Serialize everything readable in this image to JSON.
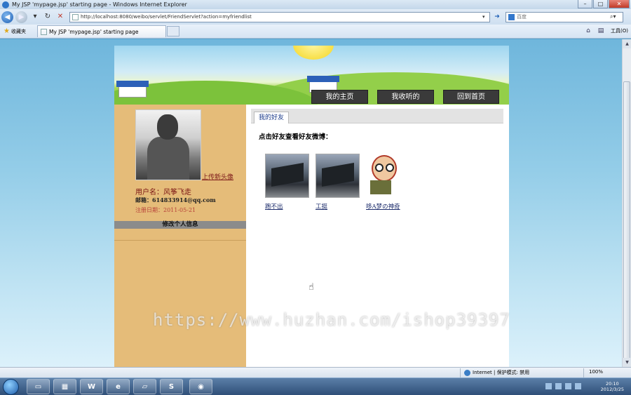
{
  "window": {
    "title": "My JSP 'mypage.jsp' starting page - Windows Internet Explorer",
    "minimize": "–",
    "maximize": "□",
    "close": "✕"
  },
  "browser": {
    "url": "http://localhost:8080/weibo/servlet/FriendServlet?action=myfriendlist",
    "search_placeholder": "百度",
    "favorites_label": "收藏夹",
    "tab_title": "My JSP 'mypage.jsp' starting page",
    "tools_label": "工具(O)",
    "status_zone": "Internet | 保护模式: 禁用",
    "zoom": "100%"
  },
  "nav": {
    "my_home": "我的主页",
    "my_following": "我收听的",
    "back_home": "回到首页"
  },
  "profile": {
    "upload_avatar": "上传新头像",
    "username": "用户名：风筝飞走",
    "email": "邮箱：614833914@qq.com",
    "register_date": "注册日期：2011-05-21",
    "edit_info": "修改个人信息"
  },
  "friends": {
    "section_title": "我的好友",
    "hint": "点击好友查看好友微博：",
    "items": [
      {
        "name": "跑不出"
      },
      {
        "name": "工挺"
      },
      {
        "name": "哆A梦の神奇"
      }
    ]
  },
  "watermark": "https://www.huzhan.com/ishop39397",
  "taskbar": {
    "word_label": "W",
    "clock_time": "20:10",
    "clock_date": "2012/3/25"
  },
  "colors": {
    "left_panel": "#e5bc79",
    "nav_button": "#3a3a3a",
    "username_text": "#7a1414"
  }
}
